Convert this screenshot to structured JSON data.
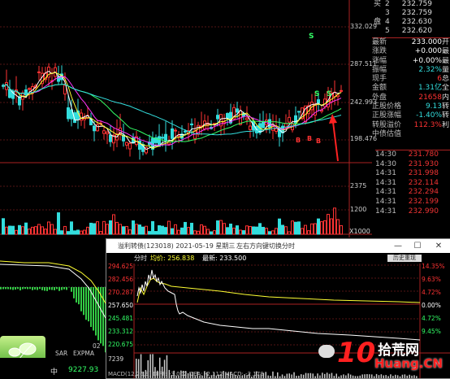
{
  "kline": {
    "price_axis": [
      "332.029",
      "287.511",
      "242.993",
      "198.476"
    ],
    "volume_axis": [
      "2375",
      "1200"
    ],
    "volume_unit": "X1000",
    "signal_labels": [
      "S",
      "S",
      "S",
      "B",
      "B",
      "B"
    ]
  },
  "right_panel": {
    "order_book": [
      {
        "label": "买",
        "num": "2",
        "price": "232.759"
      },
      {
        "label": "",
        "num": "3",
        "price": "232.759"
      },
      {
        "label": "盘",
        "num": "4",
        "price": "232.630"
      },
      {
        "label": "",
        "num": "5",
        "price": "232.620"
      }
    ],
    "stats": [
      {
        "key": "最新",
        "value": "233.000",
        "tail": "开"
      },
      {
        "key": "涨跌",
        "value": "+0.000",
        "tail": "最"
      },
      {
        "key": "涨幅",
        "value": "+0.00%",
        "tail": "最"
      },
      {
        "key": "振幅",
        "value": "2.32%",
        "tail": "量"
      },
      {
        "key": "现手",
        "value": "6",
        "tail": "总"
      },
      {
        "key": "金额",
        "value": "1.31亿",
        "tail": "全"
      },
      {
        "key": "外盘",
        "value": "21658",
        "tail": "内"
      },
      {
        "key": "正股价格",
        "value": "9.13",
        "tail": "转"
      },
      {
        "key": "正股涨幅",
        "value": "-1.40%",
        "tail": "转"
      },
      {
        "key": "转股溢价",
        "value": "112.3%",
        "tail": "利"
      },
      {
        "key": "中债估值",
        "value": "",
        "tail": ""
      }
    ],
    "ticks": [
      {
        "time": "14:30",
        "price": "231.780"
      },
      {
        "time": "14:30",
        "price": "231.930"
      },
      {
        "time": "14:31",
        "price": "231.998"
      },
      {
        "time": "14:31",
        "price": "232.114"
      },
      {
        "time": "14:31",
        "price": "232.294"
      },
      {
        "time": "14:31",
        "price": "232.199"
      },
      {
        "time": "14:31",
        "price": "232.990"
      }
    ]
  },
  "window": {
    "title": "溢利转债(123018)  2021-05-19 星期三",
    "hint": "左右方向键切换分时",
    "tab_label": "分时",
    "avg_label": "均价: 256.838",
    "last_label": "最新: 233.500",
    "history_button": "历史重现",
    "minimize": "—",
    "maximize": "☐",
    "close": "✕",
    "price_levels": [
      "294.625",
      "282.456",
      "270.287",
      "257.650",
      "245.481",
      "233.312",
      "220.675"
    ],
    "pct_levels": [
      "14.35%",
      "9.63%",
      "4.72%",
      "0.00%",
      "4.72%",
      "9.45%",
      "14.35%"
    ],
    "volume_label": "7239",
    "bottom_text": "MACD(12,26,9) DIFF: -3.002 DEA: -2.112 MACD: -2.178"
  },
  "bottom_left": {
    "tabs": [
      "SAR",
      "EXPMA"
    ],
    "tab_suffix": "02",
    "index_label": "中",
    "index_value": "9227.93"
  },
  "watermark": {
    "brand_num": "10",
    "brand_cn": "拾荒网",
    "brand_en": "Huang.CN"
  },
  "colors": {
    "up": "#ff3333",
    "down": "#33dddd",
    "avg_line": "#ffff33",
    "price_line": "#ffffff"
  }
}
